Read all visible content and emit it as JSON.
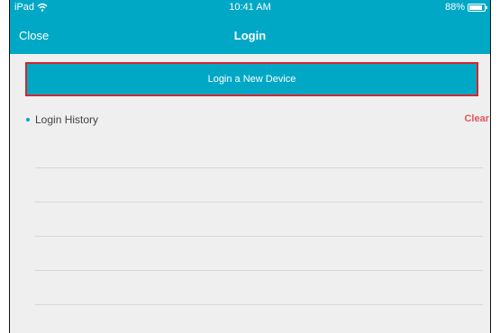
{
  "status_bar": {
    "carrier": "iPad",
    "wifi_icon": "wifi-icon",
    "time": "10:41 AM",
    "battery_percent": "88%",
    "battery_level": 0.88
  },
  "nav": {
    "close_label": "Close",
    "title": "Login"
  },
  "login_button": {
    "label": "Login a New Device"
  },
  "history": {
    "title": "Login History",
    "clear_label": "Clear",
    "rows": [
      "",
      "",
      "",
      "",
      ""
    ]
  },
  "colors": {
    "accent": "#00a8c6",
    "highlight_border": "#d8232a",
    "clear": "#e7545a",
    "background": "#efefef"
  }
}
